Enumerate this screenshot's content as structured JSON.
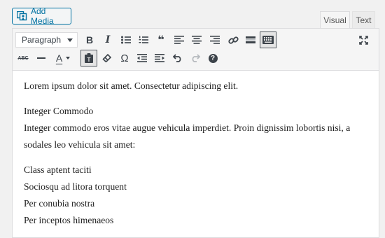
{
  "add_media": {
    "label": "Add Media",
    "icon": "add-media-icon"
  },
  "tabs": [
    {
      "label": "Visual",
      "active": true
    },
    {
      "label": "Text",
      "active": false
    }
  ],
  "toolbar": {
    "format_select": {
      "value": "Paragraph"
    },
    "row1": [
      "bold-icon",
      "italic-icon",
      "bulleted-list-icon",
      "numbered-list-icon",
      "blockquote-icon",
      "align-left-icon",
      "align-center-icon",
      "align-right-icon",
      "insert-link-icon",
      "read-more-icon",
      "toolbar-toggle-icon"
    ],
    "row2": [
      "strikethrough-icon",
      "horizontal-line-icon",
      "text-color-icon",
      "paste-as-text-icon",
      "clear-formatting-icon",
      "special-character-icon",
      "decrease-indent-icon",
      "increase-indent-icon",
      "undo-icon",
      "redo-icon",
      "keyboard-shortcuts-icon"
    ],
    "fullscreen": "distraction-free-icon",
    "glyphs": {
      "bold": "B",
      "italic": "I",
      "strike": "ABC",
      "color": "A",
      "omega": "Ω",
      "quote": "❝",
      "help": "?"
    }
  },
  "content": {
    "p1": "Lorem ipsum dolor sit amet. Consectetur adipiscing elit.",
    "p2_line1": "Integer Commodo",
    "p2_line2": "Integer commodo eros vitae augue vehicula imperdiet. Proin dignissim lobortis nisi, a sodales leo vehicula sit amet:",
    "list": [
      "Class aptent taciti",
      "Sociosqu ad litora torquent",
      "Per conubia nostra",
      "Per inceptos himenaeos"
    ]
  },
  "colors": {
    "accent": "#0071a1",
    "toolbar_bg": "#f5f5f5",
    "border": "#dcdcde"
  }
}
